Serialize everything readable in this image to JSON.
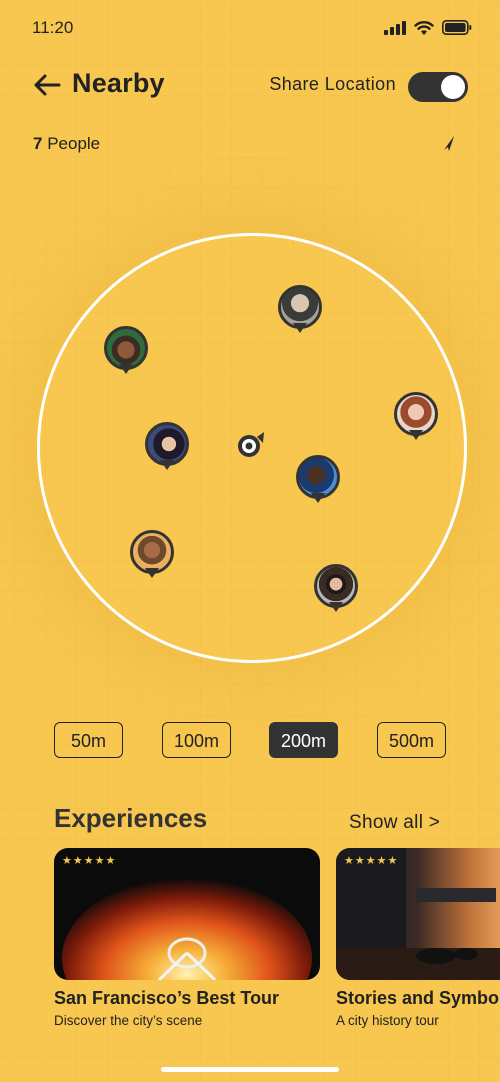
{
  "status_bar": {
    "time": "11:20"
  },
  "header": {
    "title": "Nearby",
    "share_label": "Share Location",
    "share_on": true
  },
  "people": {
    "count": "7",
    "label": "People"
  },
  "ranges": [
    {
      "label": "50m",
      "active": false
    },
    {
      "label": "100m",
      "active": false
    },
    {
      "label": "200m",
      "active": true
    },
    {
      "label": "500m",
      "active": false
    }
  ],
  "experiences": {
    "title": "Experiences",
    "show_all": "Show all >",
    "cards": [
      {
        "rating": "★★★★★",
        "title": "San Francisco’s Best Tour",
        "subtitle": "Discover the city’s scene"
      },
      {
        "rating": "★★★★★",
        "title": "Stories and Symbols",
        "subtitle": "A city history tour"
      }
    ]
  },
  "colors": {
    "background": "#f8c74f",
    "dark": "#333333",
    "ring": "#ffffff"
  }
}
